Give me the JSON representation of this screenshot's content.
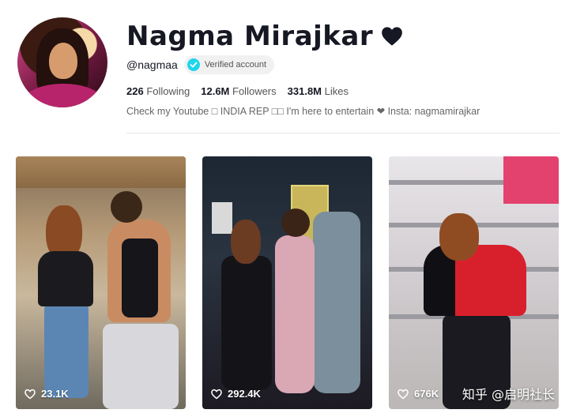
{
  "profile": {
    "display_name": "Nagma Mirajkar",
    "handle": "@nagmaa",
    "verified_label": "Verified account",
    "stats": {
      "following_value": "226",
      "following_label": "Following",
      "followers_value": "12.6M",
      "followers_label": "Followers",
      "likes_value": "331.8M",
      "likes_label": "Likes"
    },
    "bio": "Check my Youtube □ INDIA REP □□ I'm here to entertain ❤ Insta: nagmamirajkar"
  },
  "videos": [
    {
      "likes": "23.1K"
    },
    {
      "likes": "292.4K"
    },
    {
      "likes": "676K"
    }
  ],
  "watermark": "知乎 @启明社长",
  "icons": {
    "title_heart": "heart-icon",
    "verified": "checkmark-icon",
    "likes": "heart-outline-icon"
  },
  "colors": {
    "text_primary": "#161823",
    "text_secondary": "#555555",
    "verified_badge": "#20d5ec",
    "pill_bg": "#f1f1f2"
  }
}
